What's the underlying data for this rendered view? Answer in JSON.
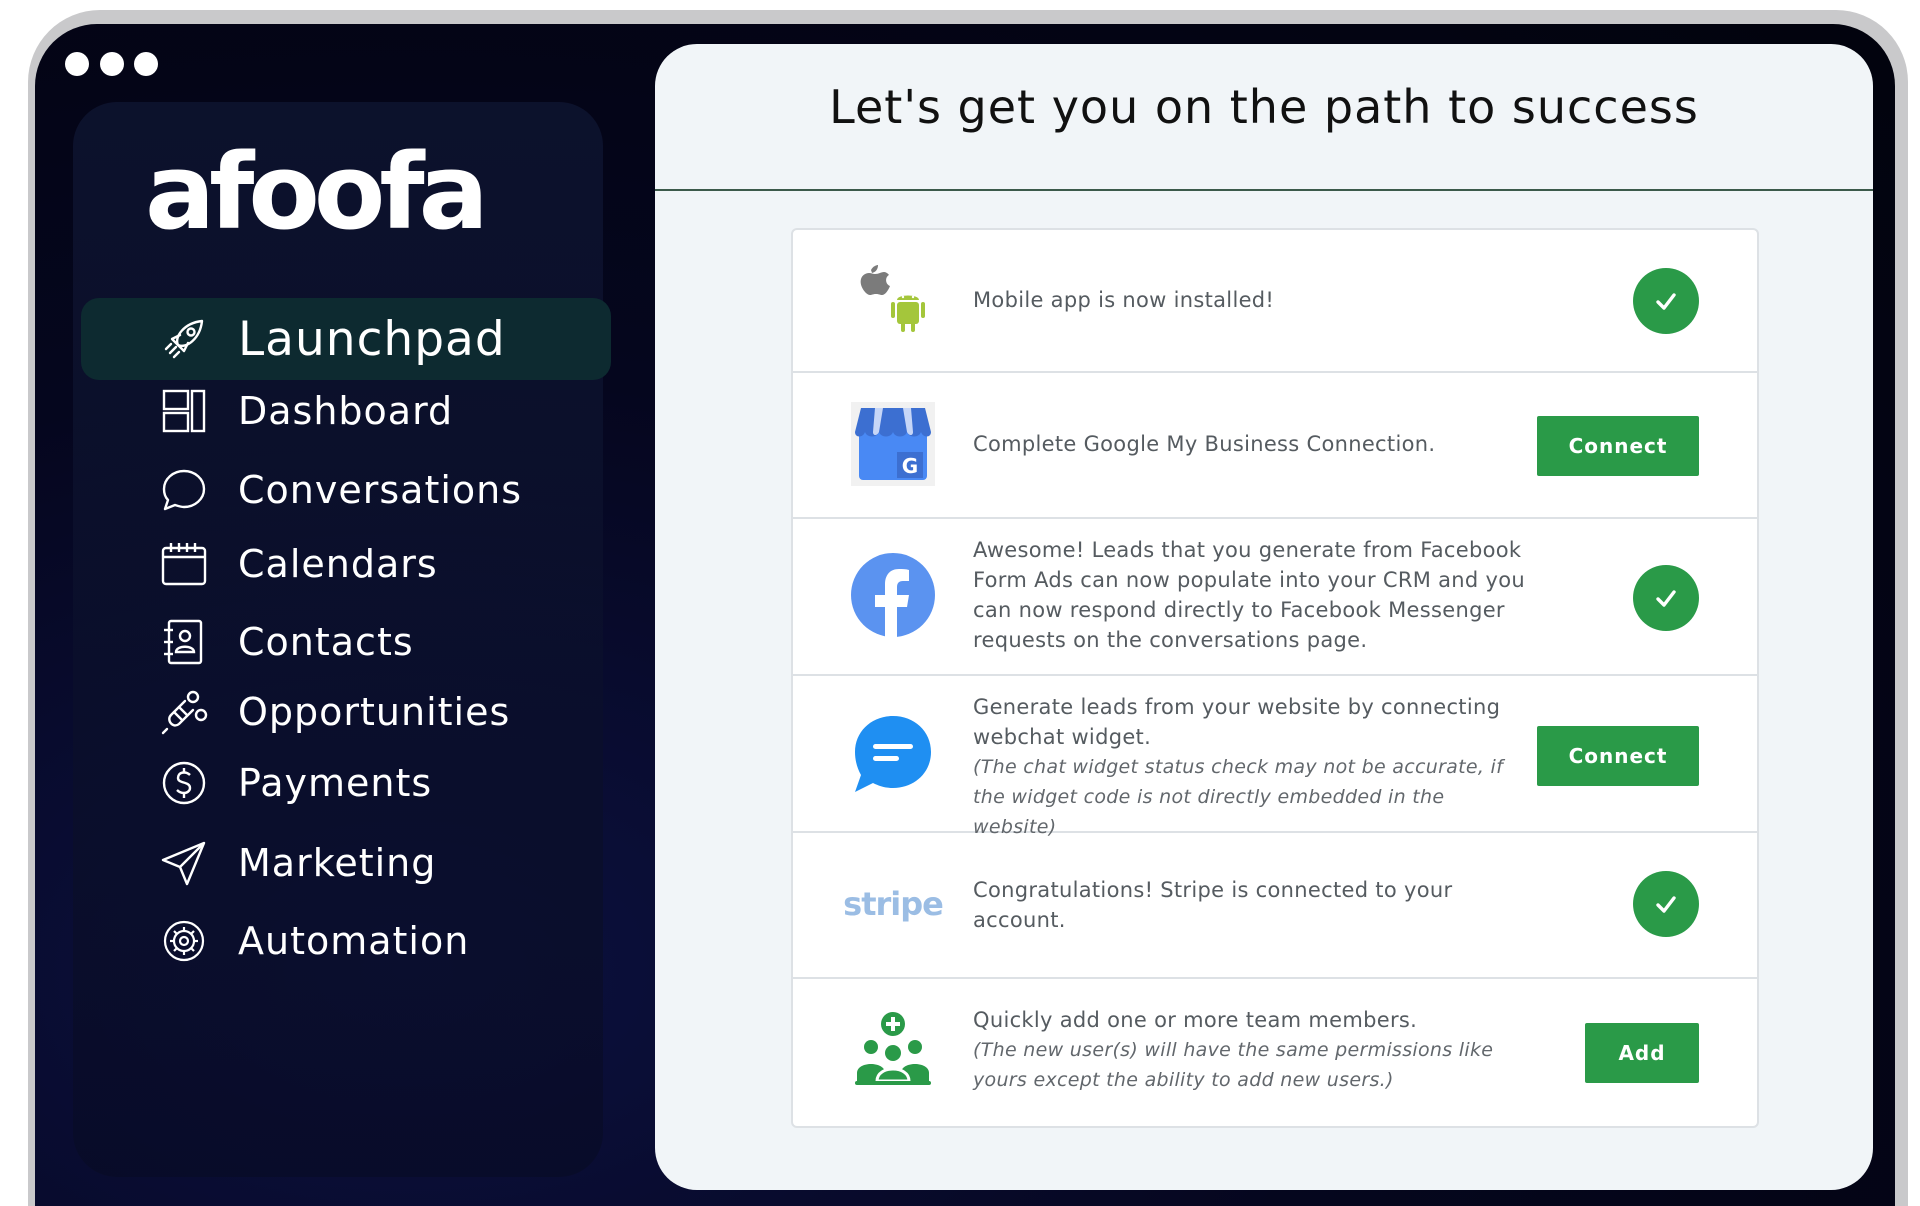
{
  "brand": {
    "logo_text": "afoofa"
  },
  "window": {
    "controls": [
      "dot",
      "dot",
      "dot"
    ]
  },
  "sidebar": {
    "items": [
      {
        "label": "Launchpad",
        "icon": "rocket-icon",
        "active": true
      },
      {
        "label": "Dashboard",
        "icon": "dashboard-icon"
      },
      {
        "label": "Conversations",
        "icon": "chat-bubble-icon"
      },
      {
        "label": "Calendars",
        "icon": "calendar-icon"
      },
      {
        "label": "Contacts",
        "icon": "contacts-book-icon"
      },
      {
        "label": "Opportunities",
        "icon": "magnet-icon"
      },
      {
        "label": "Payments",
        "icon": "dollar-circle-icon"
      },
      {
        "label": "Marketing",
        "icon": "paper-plane-icon"
      },
      {
        "label": "Automation",
        "icon": "gear-cycle-icon"
      }
    ]
  },
  "main": {
    "title": "Let's get you on the path to success",
    "tasks": [
      {
        "icon": "apple-android-icon",
        "text": "Mobile app is now installed!",
        "status": "done"
      },
      {
        "icon": "google-my-business-icon",
        "text": "Complete Google My Business Connection.",
        "action": "Connect"
      },
      {
        "icon": "facebook-icon",
        "text": "Awesome! Leads that you generate from Facebook Form Ads can now populate into your CRM and you can now respond directly to Facebook Messenger requests on the conversations page.",
        "status": "done"
      },
      {
        "icon": "webchat-icon",
        "text": "Generate leads from your website by connecting webchat widget.",
        "note": "(The chat widget status check may not be accurate, if the widget code is not directly embedded in the website)",
        "action": "Connect"
      },
      {
        "icon": "stripe-icon",
        "icon_text": "stripe",
        "text": "Congratulations! Stripe is connected to your account.",
        "status": "done"
      },
      {
        "icon": "add-team-icon",
        "text": "Quickly add one or more team members.",
        "note": "(The new user(s) will have the same permissions like yours except the ability to add new users.)",
        "action": "Add"
      }
    ]
  },
  "colors": {
    "accent_green": "#2a9a48",
    "active_nav_bg": "#0d2a30",
    "panel_bg": "#f1f5f8",
    "sidebar_bg": "#05061e"
  }
}
